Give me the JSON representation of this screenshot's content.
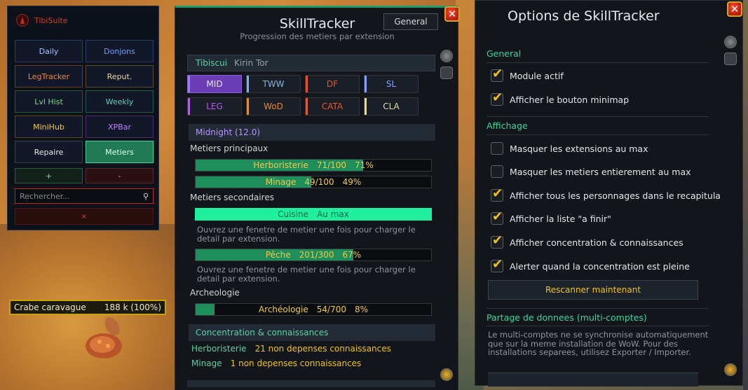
{
  "tibisuite": {
    "title": "TibiSuite",
    "buttons": [
      {
        "label": "Daily",
        "color": "#a9c4ff",
        "border": "#2a3a6a"
      },
      {
        "label": "Donjons",
        "color": "#6fa0ff",
        "border": "#2a3a6a"
      },
      {
        "label": "LegTracker",
        "color": "#f08a34",
        "border": "#6a3a1a"
      },
      {
        "label": "Reput.",
        "color": "#e6d7a0",
        "border": "#5a4a2a"
      },
      {
        "label": "Lvl Hist",
        "color": "#7ad68a",
        "border": "#235a30"
      },
      {
        "label": "Weekly",
        "color": "#5fd0b0",
        "border": "#1f5a4a"
      },
      {
        "label": "MiniHub",
        "color": "#f0c84a",
        "border": "#5a4a1a"
      },
      {
        "label": "XPBar",
        "color": "#c080ff",
        "border": "#4a2a6a"
      },
      {
        "label": "Repaire",
        "color": "#e6e6e6",
        "border": "#3a3f4a"
      },
      {
        "label": "Metiers",
        "color": "#dfffee",
        "border": "#3fd49a",
        "bg": "#1f7a55"
      }
    ],
    "plus": "+",
    "minus": "-",
    "search_placeholder": "Rechercher...",
    "clear": "×"
  },
  "nameplate": {
    "name": "Crabe caravague",
    "value": "188 k (100%)"
  },
  "skilltracker": {
    "title": "SkillTracker",
    "subtitle": "Progression des metiers par extension",
    "general_button": "General",
    "close": "✕",
    "character": {
      "name": "Tibiscui",
      "realm": "Kirin Tor"
    },
    "expansions": [
      {
        "label": "MID",
        "color": "#a07aff",
        "active": true
      },
      {
        "label": "TWW",
        "color": "#8ab0e0"
      },
      {
        "label": "DF",
        "color": "#e0552a"
      },
      {
        "label": "SL",
        "color": "#8aa0ff"
      },
      {
        "label": "LEG",
        "color": "#b060e0"
      },
      {
        "label": "WoD",
        "color": "#e08a3a"
      },
      {
        "label": "CATA",
        "color": "#e05a3a"
      },
      {
        "label": "CLA",
        "color": "#e0d8b0"
      }
    ],
    "section_title": "Midnight (12.0)",
    "primary_label": "Metiers principaux",
    "primary": [
      {
        "name": "Herboristerie",
        "value": "71/100",
        "pct": "71%",
        "fill": 0.71
      },
      {
        "name": "Minage",
        "value": "49/100",
        "pct": "49%",
        "fill": 0.49
      }
    ],
    "secondary_label": "Metiers secondaires",
    "secondary": [
      {
        "name": "Cuisine",
        "value": "Au max",
        "pct": "",
        "fill": 1.0,
        "maxed": true
      },
      {
        "name": "Pêche",
        "value": "201/300",
        "pct": "67%",
        "fill": 0.67
      }
    ],
    "note": "Ouvrez une fenetre de metier une fois pour charger le detail par extension.",
    "archeo_label": "Archeologie",
    "archeo": {
      "name": "Archéologie",
      "value": "54/700",
      "pct": "8%",
      "fill": 0.08
    },
    "conc_title": "Concentration & connaissances",
    "conc": [
      {
        "name": "Herboristerie",
        "text": "21 non depenses connaissances"
      },
      {
        "name": "Minage",
        "text": "1 non depenses connaissances"
      }
    ]
  },
  "options": {
    "title": "Options de SkillTracker",
    "close": "✕",
    "general": "General",
    "general_items": [
      {
        "label": "Module actif",
        "checked": true
      },
      {
        "label": "Afficher le bouton minimap",
        "checked": true
      }
    ],
    "display": "Affichage",
    "display_items": [
      {
        "label": "Masquer les extensions au max",
        "checked": false
      },
      {
        "label": "Masquer les metiers entierement au max",
        "checked": false
      },
      {
        "label": "Afficher tous les personnages dans le recapitula",
        "checked": true
      },
      {
        "label": "Afficher la liste \"a finir\"",
        "checked": true
      },
      {
        "label": "Afficher concentration & connaissances",
        "checked": true
      },
      {
        "label": "Alerter quand la concentration est pleine",
        "checked": true
      }
    ],
    "rescan": "Rescanner maintenant",
    "share": "Partage de donnees (multi-comptes)",
    "share_note": "Le multi-comptes ne se synchronise automatiquement que sur la meme installation de WoW. Pour des installations separees, utilisez Exporter / Importer."
  }
}
